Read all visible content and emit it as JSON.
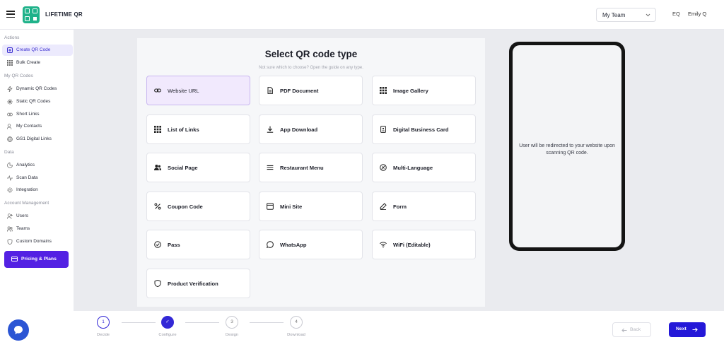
{
  "header": {
    "brand": "LIFETIME QR",
    "team_select": "My Team",
    "avatar_initials": "EQ",
    "user_name": "Emily Q"
  },
  "sidebar": {
    "sections": {
      "actions": "Actions",
      "my_qr_codes": "My QR Codes",
      "data": "Data",
      "account": "Account Management"
    },
    "items": [
      {
        "label": "Create QR Code",
        "icon": "plus-square-icon",
        "active": true
      },
      {
        "label": "Bulk Create",
        "icon": "grid-icon"
      },
      {
        "label": "Dynamic QR Codes",
        "icon": "lightning-icon"
      },
      {
        "label": "Static QR Codes",
        "icon": "sparkle-icon"
      },
      {
        "label": "Short Links",
        "icon": "link-icon"
      },
      {
        "label": "My Contacts",
        "icon": "contacts-icon"
      },
      {
        "label": "GS1 Digital Links",
        "icon": "globe-link-icon"
      },
      {
        "label": "Analytics",
        "icon": "pie-chart-icon"
      },
      {
        "label": "Scan Data",
        "icon": "activity-icon"
      },
      {
        "label": "Integration",
        "icon": "gear-icon"
      },
      {
        "label": "Users",
        "icon": "user-add-icon"
      },
      {
        "label": "Teams",
        "icon": "team-icon"
      },
      {
        "label": "Custom Domains",
        "icon": "shield-icon"
      }
    ],
    "pricing_label": "Pricing & Plans"
  },
  "main": {
    "title": "Select QR code type",
    "subtitle": "Not sure which to choose? Open the guide on any type.",
    "types": [
      {
        "label": "Website URL",
        "icon": "link-icon",
        "selected": true
      },
      {
        "label": "PDF Document",
        "icon": "document-icon"
      },
      {
        "label": "Image Gallery",
        "icon": "grid-icon"
      },
      {
        "label": "List of Links",
        "icon": "grid-icon"
      },
      {
        "label": "App Download",
        "icon": "download-icon"
      },
      {
        "label": "Digital Business Card",
        "icon": "business-card-icon"
      },
      {
        "label": "Social Page",
        "icon": "people-icon"
      },
      {
        "label": "Restaurant Menu",
        "icon": "menu-lines-icon"
      },
      {
        "label": "Multi-Language",
        "icon": "translate-icon"
      },
      {
        "label": "Coupon Code",
        "icon": "percent-icon"
      },
      {
        "label": "Mini Site",
        "icon": "browser-window-icon"
      },
      {
        "label": "Form",
        "icon": "pen-icon"
      },
      {
        "label": "Pass",
        "icon": "check-circle-icon"
      },
      {
        "label": "WhatsApp",
        "icon": "chat-bubble-icon"
      },
      {
        "label": "WiFi (Editable)",
        "icon": "wifi-icon"
      },
      {
        "label": "Product Verification",
        "icon": "shield-icon"
      }
    ],
    "preview_text": "User will be redirected to your website upon scanning QR code."
  },
  "stepper": {
    "steps": [
      {
        "num": "1",
        "label": "Decide",
        "state": "current"
      },
      {
        "num": "✓",
        "label": "Configure",
        "state": "done"
      },
      {
        "num": "3",
        "label": "Design",
        "state": "pending"
      },
      {
        "num": "4",
        "label": "Download",
        "state": "pending"
      }
    ]
  },
  "footer": {
    "back_label": "Back",
    "next_label": "Next"
  },
  "colors": {
    "accent": "#3328d6",
    "brand_green": "#1fb28a",
    "pricing_purple": "#5321e3",
    "selected_card": "#f1e9fd"
  }
}
